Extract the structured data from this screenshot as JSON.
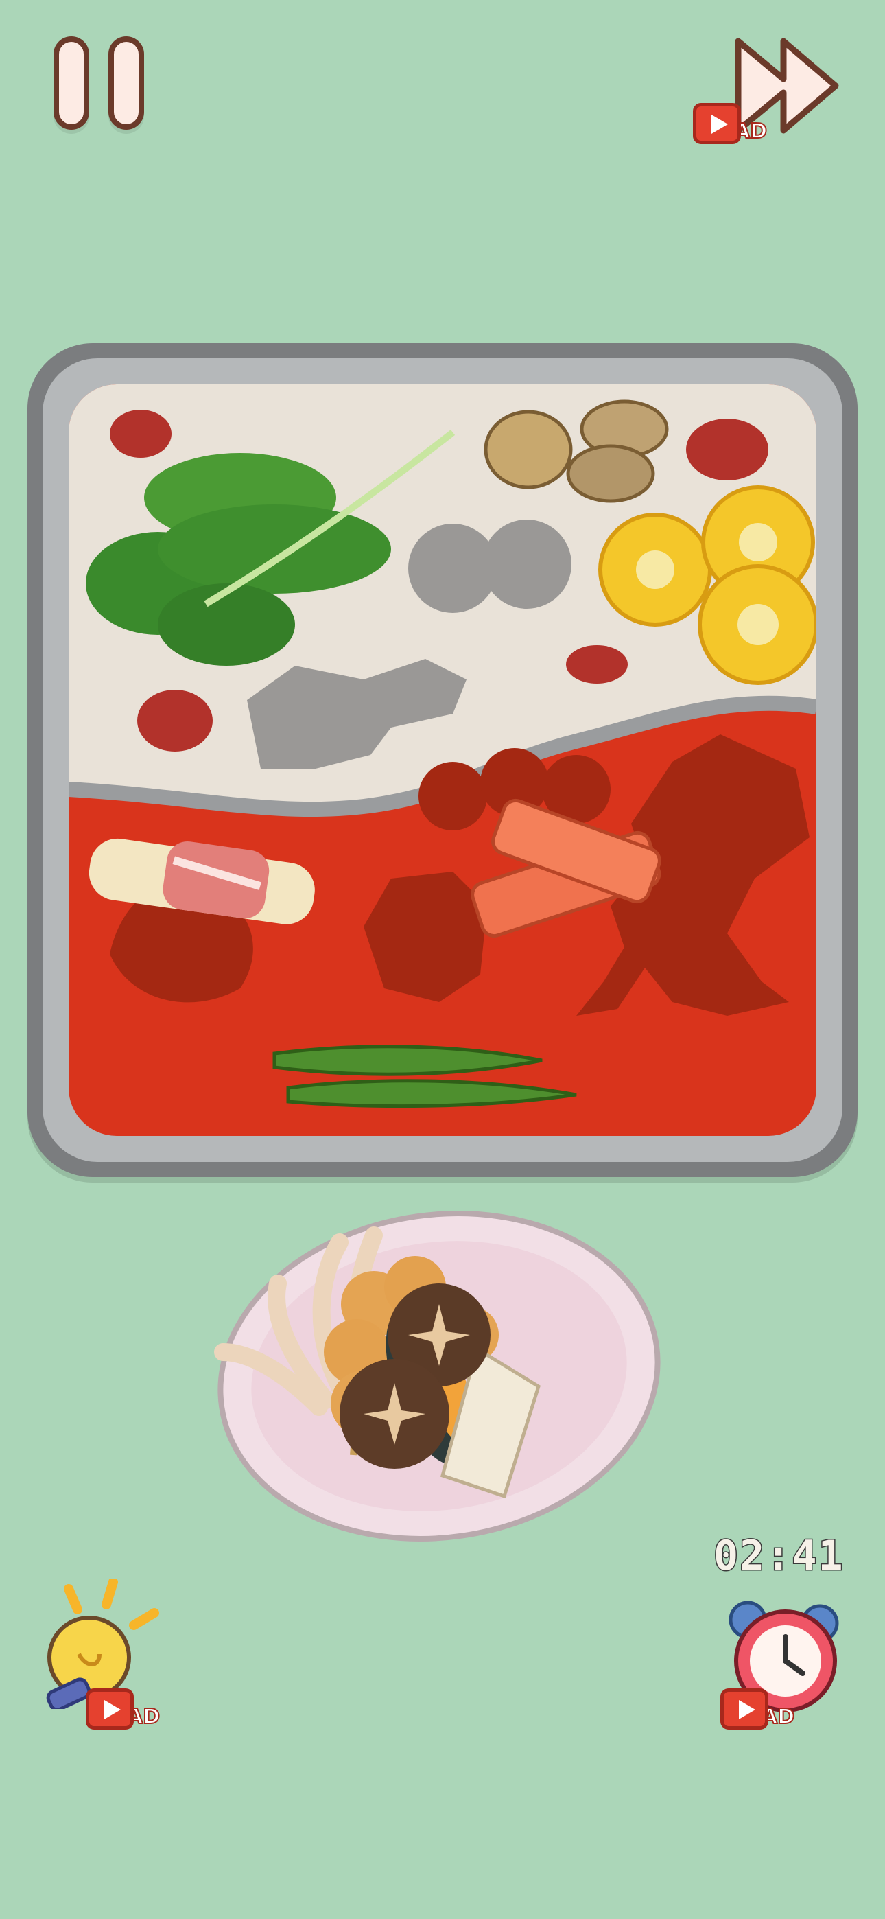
{
  "hud": {
    "pause_icon": "pause-icon",
    "skip_icon": "fast-forward-icon",
    "ad_label": "AD",
    "timer": "02:41",
    "hint_icon": "lightbulb-icon",
    "time_icon": "alarm-clock-icon"
  },
  "colors": {
    "background": "#abd6b8",
    "white_broth": "#e9e2d8",
    "red_broth": "#d9341c",
    "tray_frame": "#7b7d7f",
    "ad_red": "#e5412f"
  },
  "pot_items": [
    {
      "name": "bok-choy",
      "state": "placed"
    },
    {
      "name": "clams",
      "state": "placed"
    },
    {
      "name": "corn",
      "state": "placed"
    },
    {
      "name": "sausage",
      "state": "placed"
    },
    {
      "name": "enoki-bacon-roll",
      "state": "placed"
    },
    {
      "name": "crab-sticks",
      "state": "placed"
    },
    {
      "name": "okra",
      "state": "placed"
    },
    {
      "name": "fish-balls-skewer",
      "state": "empty-slot"
    },
    {
      "name": "squid",
      "state": "empty-slot"
    },
    {
      "name": "tofu",
      "state": "empty-slot"
    },
    {
      "name": "mussels",
      "state": "empty-slot"
    },
    {
      "name": "shiitake",
      "state": "empty-slot"
    },
    {
      "name": "fish-tofu",
      "state": "empty-slot"
    }
  ],
  "plate_items": [
    "squid-tentacles",
    "fish-balls-skewer",
    "shiitake-mushrooms",
    "mussel",
    "fish-tofu"
  ]
}
